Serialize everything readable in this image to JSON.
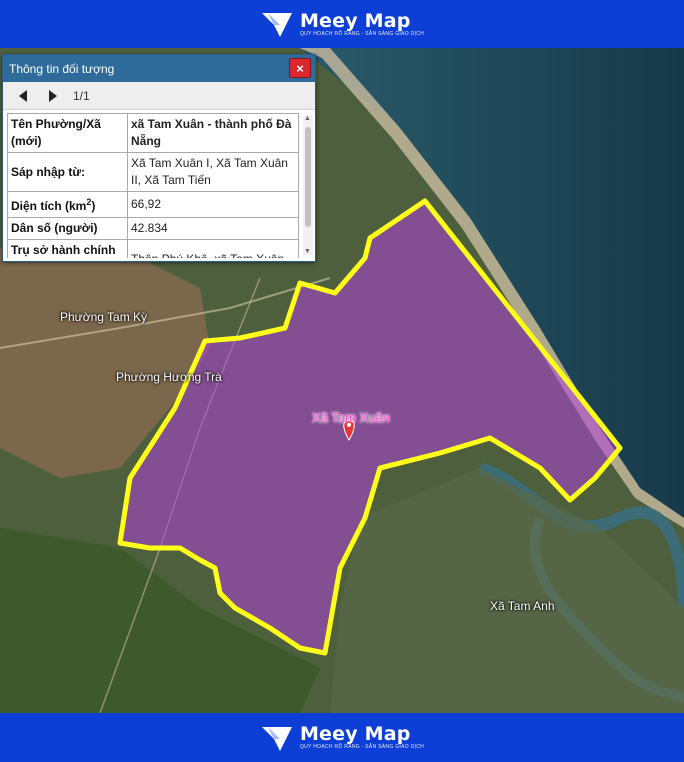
{
  "brand": {
    "name": "Meey Map",
    "tagline": "QUY HOẠCH RÕ RÀNG - SẴN SÀNG GIAO DỊCH"
  },
  "info_panel": {
    "title": "Thông tin đối tượng",
    "close_label": "×",
    "pager": "1/1",
    "rows": [
      {
        "key": "Tên Phường/Xã (mới)",
        "value": "xã Tam Xuân - thành phố Đà Nẵng"
      },
      {
        "key": "Sáp nhập từ:",
        "value": "Xã Tam Xuân I, Xã Tam Xuân II, Xã Tam Tiến"
      },
      {
        "key_base": "Diện tích (km",
        "key_sup": "2",
        "key_end": ")",
        "value": "66,92"
      },
      {
        "key": "Dân số (người)",
        "value": "42.834"
      },
      {
        "key": "Trụ sở hành chính (mới)",
        "value": "Thôn Phú Khê, xã Tam Xuân"
      }
    ]
  },
  "map": {
    "labels": {
      "tam_ky": "Phường Tam Kỳ",
      "huong_tra": "Phường Hương Trà",
      "tam_xuan": "Xã Tam Xuân",
      "tam_anh": "Xã Tam Anh"
    },
    "colors": {
      "boundary": "#ffff1a",
      "fill": "#b040d8",
      "sea": "#1e4a5c",
      "land": "#4b5e3a",
      "marker": "#e8333a"
    }
  }
}
